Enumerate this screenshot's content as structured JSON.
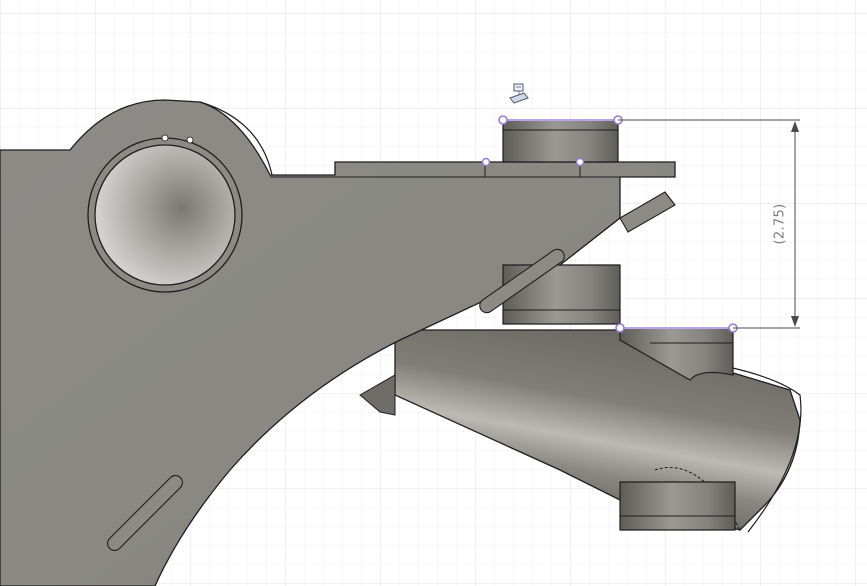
{
  "viewport": {
    "background": "#ffffff",
    "grid_minor_color": "#eef0f3",
    "grid_major_color": "#dfe3e8"
  },
  "model": {
    "body_color": "#8b8a85",
    "edge_color": "#1e1e1e",
    "tube_dark": "#5f5d57",
    "tube_light": "#b9b7b0",
    "bore_inner": "#b9b8b5"
  },
  "sketch": {
    "point_color": "#9a78d9",
    "line_color": "#b9a4ea"
  },
  "dimension": {
    "label": "(2.75)",
    "line_color": "#4a4a4a"
  },
  "icons": {
    "sketch_marker": "sketch-marker-icon"
  }
}
